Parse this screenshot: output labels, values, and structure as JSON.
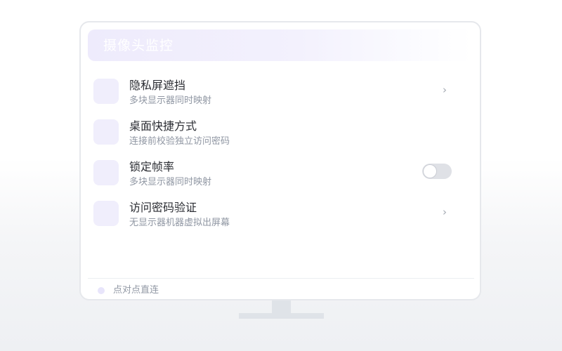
{
  "window": {
    "title": "摄像头监控"
  },
  "settings": {
    "items": [
      {
        "title": "隐私屏遮挡",
        "subtitle": "多块显示器同时映射",
        "control": "chevron",
        "control_icon": "chevron-right-icon"
      },
      {
        "title": "桌面快捷方式",
        "subtitle": "连接前校验独立访问密码",
        "control": "none"
      },
      {
        "title": "锁定帧率",
        "subtitle": "多块显示器同时映射",
        "control": "toggle",
        "toggle_on": false
      },
      {
        "title": "访问密码验证",
        "subtitle": "无显示器机器虚拟出屏幕",
        "control": "chevron",
        "control_icon": "chevron-right-icon"
      }
    ],
    "chevron_glyph": "›"
  },
  "status": {
    "label": "点对点直连"
  },
  "colors": {
    "accent_tint": "#f0eefc",
    "header_tint": "#eeebfc",
    "toggle_off": "#dfe1e6",
    "text_primary": "#2b2d33",
    "text_secondary": "#9097a3"
  }
}
